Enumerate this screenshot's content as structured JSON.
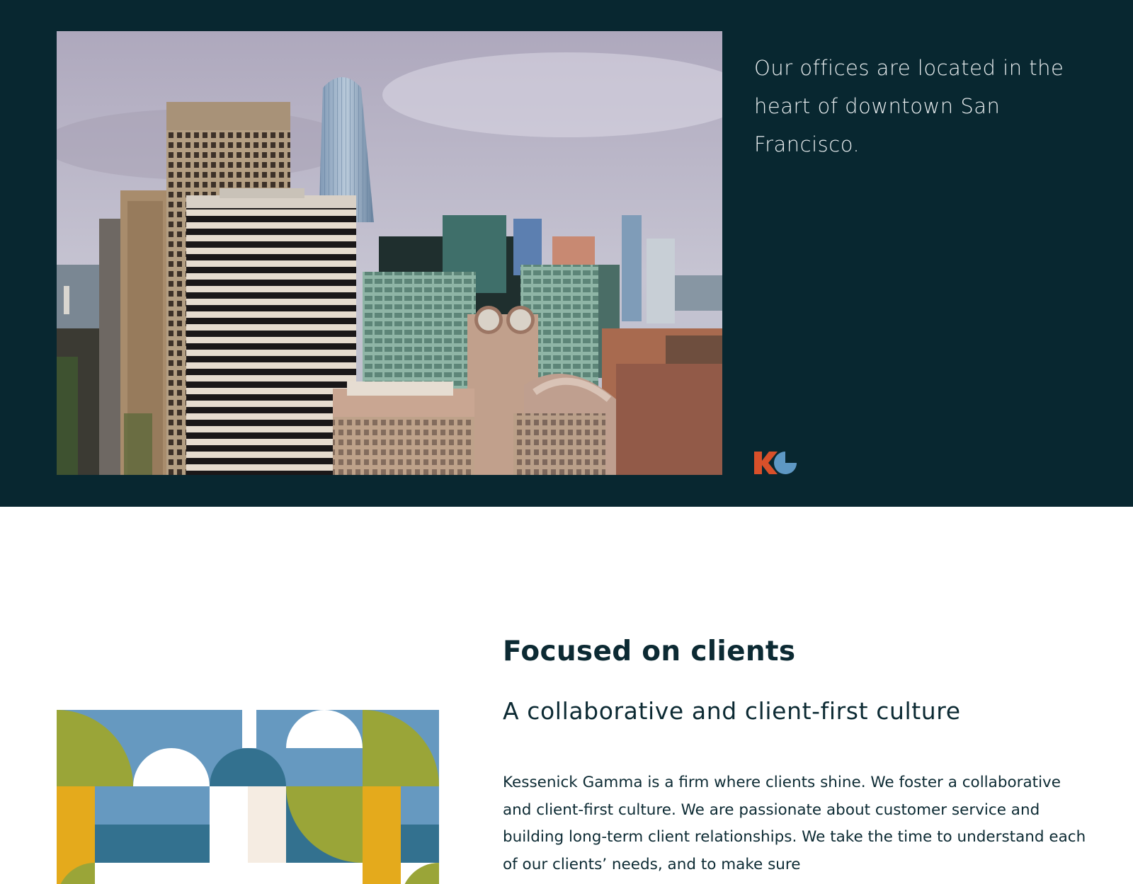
{
  "hero": {
    "caption": "Our offices are located in the heart of downtown San Francisco."
  },
  "logo": {
    "name": "KG",
    "colors": {
      "k": "#d8502a",
      "g": "#5e98c4"
    }
  },
  "section": {
    "heading": "Focused on clients",
    "subheading": "A collaborative and client-first culture",
    "body": "Kessenick Gamma is a firm where clients shine. We foster a collaborative and client-first culture. We are passionate about customer service and building long-term client relationships.  We take the time to understand each of our clients’ needs, and to make sure"
  },
  "colors": {
    "navy": "#082730",
    "text_dark": "#0c2a33",
    "blue": "#6699c0",
    "dark_blue": "#33718f",
    "olive": "#9aa538",
    "gold": "#e4aa1c",
    "cream": "#f5ece2"
  }
}
